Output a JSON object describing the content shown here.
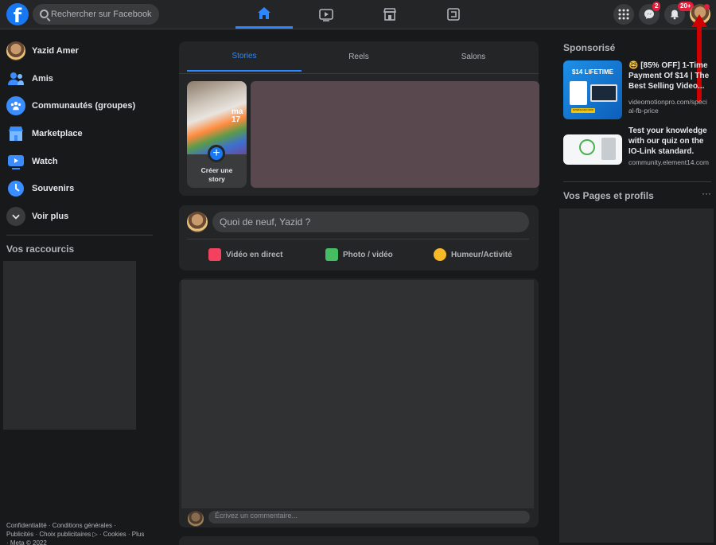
{
  "header": {
    "logo_letter": "f",
    "search_placeholder": "Rechercher sur Facebook",
    "messenger_badge": "2",
    "notifications_badge": "20+"
  },
  "left": {
    "user_name": "Yazid Amer",
    "items": [
      {
        "label": "Amis",
        "icon": "friends-icon",
        "color": "#3a8dff"
      },
      {
        "label": "Communautés (groupes)",
        "icon": "groups-icon",
        "color": "#3a8dff"
      },
      {
        "label": "Marketplace",
        "icon": "marketplace-icon",
        "color": "#3a8dff"
      },
      {
        "label": "Watch",
        "icon": "watch-icon",
        "color": "#3a8dff"
      },
      {
        "label": "Souvenirs",
        "icon": "memories-icon",
        "color": "#3a8dff"
      },
      {
        "label": "Voir plus",
        "icon": "chevron-down-icon",
        "color": "#3a3b3c"
      }
    ],
    "shortcuts_title": "Vos raccourcis",
    "footer_line1": "Confidentialité · Conditions générales ·",
    "footer_line2": "Publicités · Choix publicitaires ▷ · Cookies · Plus",
    "footer_line3": "· Meta © 2022"
  },
  "stories": {
    "tabs": [
      "Stories",
      "Reels",
      "Salons"
    ],
    "active_tab": "Stories",
    "create_line1": "Créer une",
    "create_line2": "story",
    "photo_text": "ma\n17"
  },
  "composer": {
    "placeholder": "Quoi de neuf, Yazid ?",
    "actions": [
      {
        "label": "Vidéo en direct",
        "icon": "live-video-icon",
        "color": "#f3425f"
      },
      {
        "label": "Photo / vidéo",
        "icon": "photo-icon",
        "color": "#45bd62"
      },
      {
        "label": "Humeur/Activité",
        "icon": "feeling-icon",
        "color": "#f7b928"
      }
    ]
  },
  "post": {
    "comment_placeholder": "Écrivez un commentaire..."
  },
  "right": {
    "sponsored_title": "Sponsorisé",
    "ads": [
      {
        "text": "🤓 [85% OFF] 1-Time Payment Of $14 | The Best Selling Video...",
        "domain": "videomotionpro.com/special-fb-price",
        "thumb_label": "$14 LIFETIME",
        "thumb_sub": "DOWNLOAD NOW"
      },
      {
        "text": "Test your knowledge with our quiz on the IO-Link standard.",
        "domain": "community.element14.com",
        "thumb_label": "",
        "thumb_sub": ""
      }
    ],
    "pages_title": "Vos Pages et profils",
    "pages_more": "···"
  }
}
